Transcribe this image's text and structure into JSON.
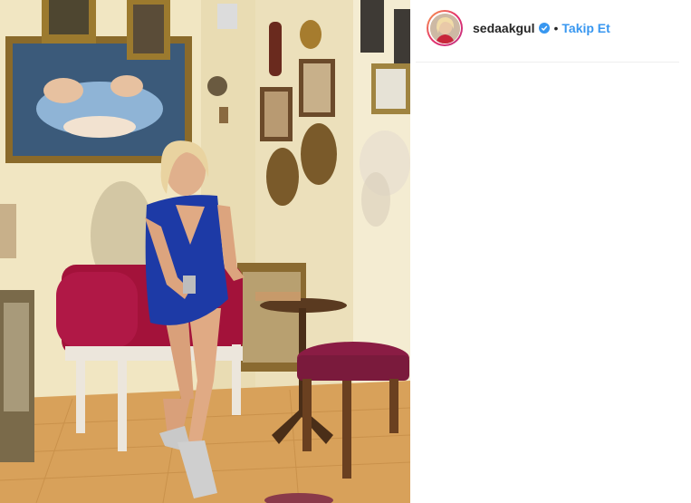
{
  "post": {
    "username": "sedaakgul",
    "separator": "•",
    "follow_label": "Takip Et",
    "verified": true
  },
  "colors": {
    "link_blue": "#3897f0",
    "text": "#262626",
    "divider": "#efefef"
  },
  "icons": {
    "verified": "verified-badge-icon"
  }
}
